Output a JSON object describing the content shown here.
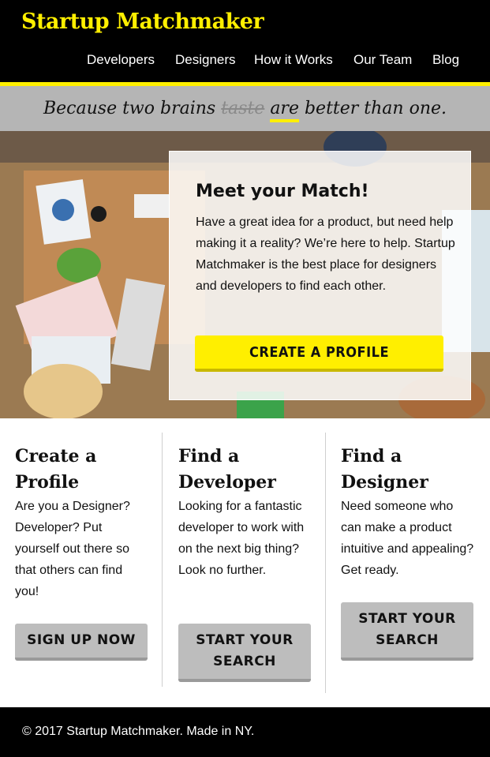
{
  "colors": {
    "accent_yellow": "#ffef00",
    "header_bg": "#000000",
    "button_gray": "#bdbdbd",
    "tagline_bg": "#b5b5b5"
  },
  "header": {
    "logo": "Startup Matchmaker",
    "nav": [
      "Developers",
      "Designers",
      "How it Works",
      "Our Team",
      "Blog"
    ]
  },
  "tagline": {
    "before": "Because two brains",
    "struck": "taste",
    "underlined": "are",
    "after": "better than one."
  },
  "hero": {
    "image": "office-team-desk-photo",
    "card_title": "Meet your Match!",
    "card_body": "Have a great idea for a product, but need help making it a reality? We’re here to help. Startup Matchmaker is the best place for designers and developers to find each other.",
    "cta_label": "CREATE A PROFILE"
  },
  "columns": [
    {
      "title": "Create a Profile",
      "body": "Are you a Designer? Developer? Put yourself out there so that others can find you!",
      "button": "SIGN UP NOW"
    },
    {
      "title": "Find a Developer",
      "body": "Looking for a fantastic developer to work with on the next big thing? Look no further.",
      "button": "START YOUR SEARCH"
    },
    {
      "title": "Find a Designer",
      "body": "Need someone who can make a product intuitive and appealing? Get ready.",
      "button": "START YOUR SEARCH"
    }
  ],
  "footer": {
    "text": "© 2017 Startup Matchmaker. Made in NY."
  }
}
